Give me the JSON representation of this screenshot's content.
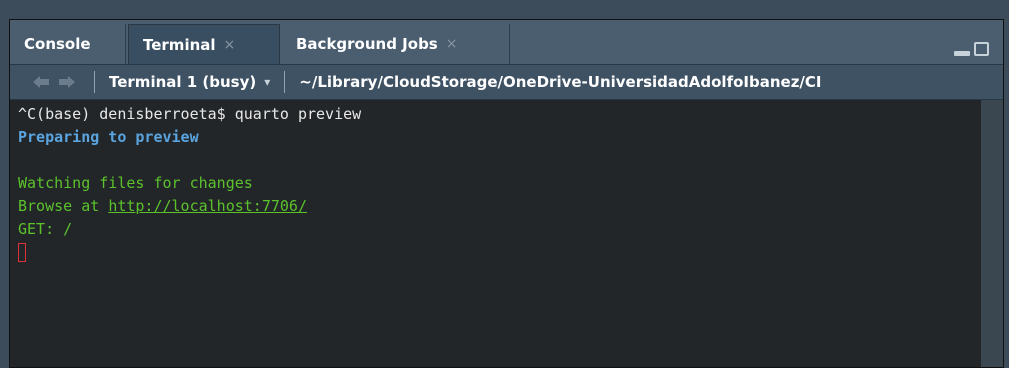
{
  "tabs": [
    {
      "label": "Console",
      "closable": false,
      "active": false
    },
    {
      "label": "Terminal",
      "closable": true,
      "active": true
    },
    {
      "label": "Background Jobs",
      "closable": true,
      "active": false
    }
  ],
  "tab_close_glyph": "×",
  "toolbar": {
    "back_icon": "arrow-left-icon",
    "forward_icon": "arrow-right-icon",
    "terminal_select": "Terminal 1 (busy)",
    "caret_icon": "chevron-down-icon",
    "path": "~/Library/CloudStorage/OneDrive-UniversidadAdolfoIbanez/CI"
  },
  "terminal": {
    "lines": [
      {
        "text": "^C(base) denisberroeta$ quarto preview",
        "style": "white"
      },
      {
        "text": "Preparing to preview",
        "style": "blue"
      },
      {
        "text": "",
        "style": "white"
      },
      {
        "text": "Watching files for changes",
        "style": "green"
      },
      {
        "prefix": "Browse at ",
        "link": "http://localhost:7706/",
        "style": "green"
      },
      {
        "text": "GET: /",
        "style": "green"
      }
    ]
  },
  "colors": {
    "prompt": "#e8e8e8",
    "info": "#5aa4e0",
    "success": "#5cc22c",
    "cursor": "#e0303a",
    "background": "#222628"
  }
}
